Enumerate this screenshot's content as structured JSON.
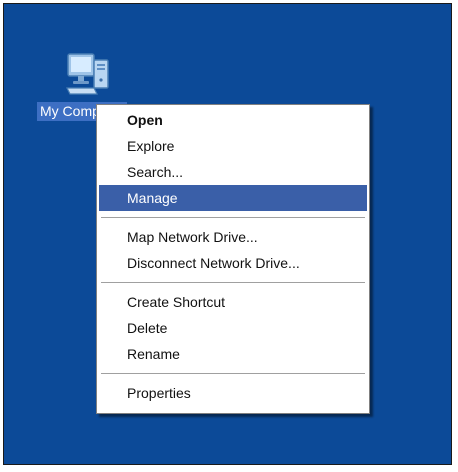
{
  "desktop": {
    "background_color": "#0c4a98",
    "icon": {
      "icon_name": "my-computer-icon",
      "label": "My Computer"
    }
  },
  "context_menu": {
    "highlight_color": "#3a5fa8",
    "groups": [
      [
        {
          "label": "Open",
          "bold": true
        },
        {
          "label": "Explore"
        },
        {
          "label": "Search..."
        },
        {
          "label": "Manage",
          "highlighted": true
        }
      ],
      [
        {
          "label": "Map Network Drive..."
        },
        {
          "label": "Disconnect Network Drive..."
        }
      ],
      [
        {
          "label": "Create Shortcut"
        },
        {
          "label": "Delete"
        },
        {
          "label": "Rename"
        }
      ],
      [
        {
          "label": "Properties"
        }
      ]
    ]
  }
}
